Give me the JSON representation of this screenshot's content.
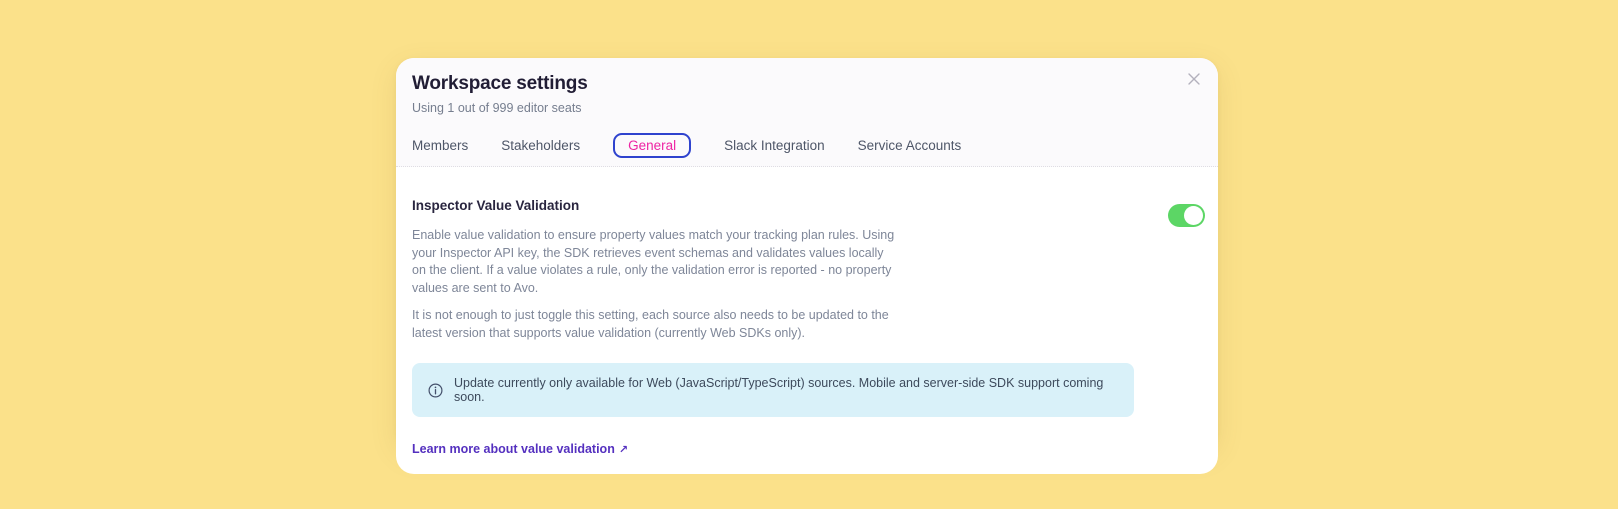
{
  "modal": {
    "title": "Workspace settings",
    "subtitle": "Using 1 out of 999 editor seats",
    "tabs": [
      {
        "label": "Members",
        "active": false
      },
      {
        "label": "Stakeholders",
        "active": false
      },
      {
        "label": "General",
        "active": true
      },
      {
        "label": "Slack Integration",
        "active": false
      },
      {
        "label": "Service Accounts",
        "active": false
      }
    ],
    "content": {
      "section_title": "Inspector Value Validation",
      "toggle": {
        "state": "on"
      },
      "paragraph1": "Enable value validation to ensure property values match your tracking plan rules. Using your Inspector API key, the SDK retrieves event schemas and validates values locally on the client. If a value violates a rule, only the validation error is reported - no property values are sent to Avo.",
      "paragraph2": "It is not enough to just toggle this setting, each source also needs to be updated to the latest version that supports value validation (currently Web SDKs only).",
      "info_banner": {
        "text": "Update currently only available for Web (JavaScript/TypeScript) sources. Mobile and server-side SDK support coming soon."
      },
      "link": {
        "label": "Learn more about value validation",
        "arrow": "↗"
      }
    }
  },
  "colors": {
    "page_background": "#FBE18A",
    "active_tab_pink": "#EE23A3",
    "focus_ring_blue": "#2F43CE",
    "toggle_green": "#5CD665",
    "banner_blue": "#D9F1F9",
    "link_purple": "#5430BF"
  }
}
